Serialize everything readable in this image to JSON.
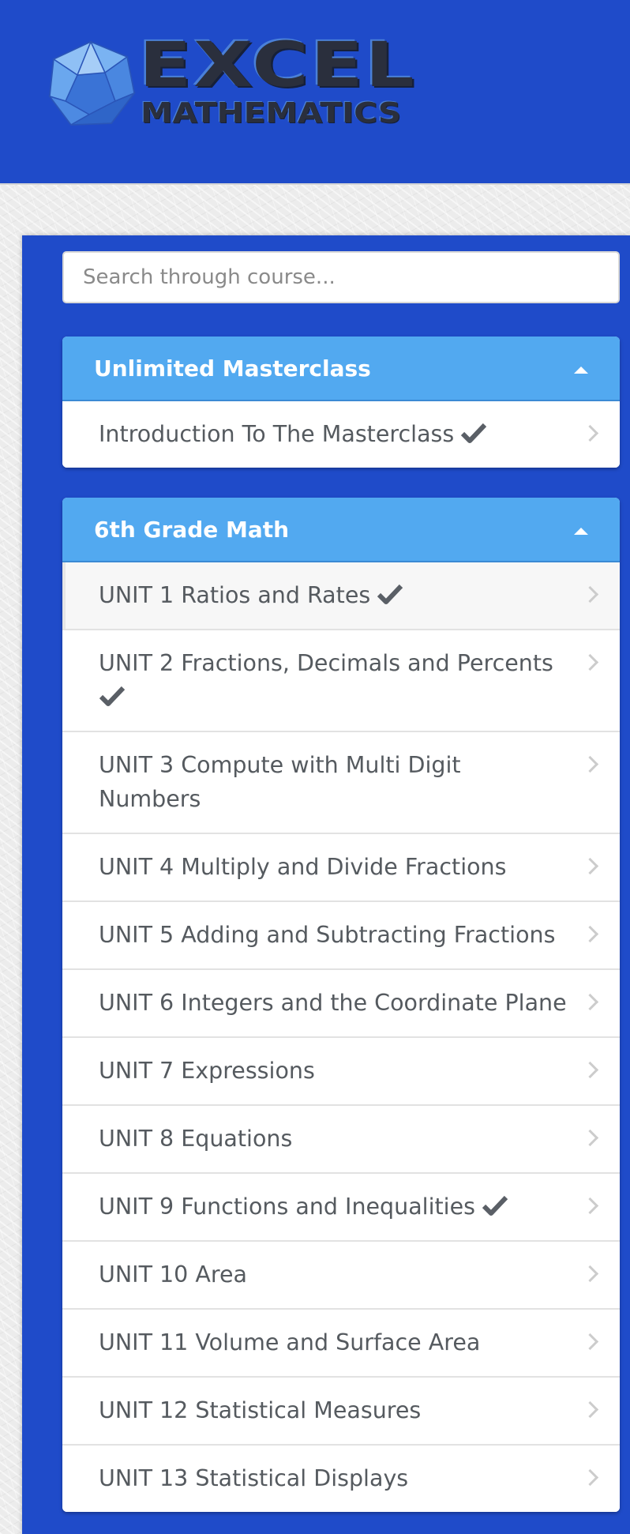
{
  "header": {
    "brand_main": "EXCEL",
    "brand_sub": "MATHEMATICS",
    "bg_color": "#1f4bc9"
  },
  "sidebar": {
    "search": {
      "placeholder": "Search through course...",
      "value": ""
    },
    "sections": [
      {
        "title": "Unlimited Masterclass",
        "expanded": true,
        "items": [
          {
            "label": "Introduction To The Masterclass",
            "completed": true
          }
        ]
      },
      {
        "title": "6th Grade Math",
        "expanded": true,
        "items": [
          {
            "label": "UNIT 1 Ratios and Rates",
            "completed": true,
            "active": true
          },
          {
            "label": "UNIT 2 Fractions, Decimals and Percents",
            "completed": true
          },
          {
            "label": "UNIT 3 Compute with Multi Digit Numbers",
            "completed": false
          },
          {
            "label": "UNIT 4 Multiply and Divide Fractions",
            "completed": false
          },
          {
            "label": "UNIT 5 Adding and Subtracting Fractions",
            "completed": false
          },
          {
            "label": "UNIT 6 Integers and the Coordinate Plane",
            "completed": false
          },
          {
            "label": "UNIT 7 Expressions",
            "completed": false
          },
          {
            "label": "UNIT 8 Equations",
            "completed": false
          },
          {
            "label": "UNIT 9 Functions and Inequalities",
            "completed": true
          },
          {
            "label": "UNIT 10 Area",
            "completed": false
          },
          {
            "label": "UNIT 11 Volume and Surface Area",
            "completed": false
          },
          {
            "label": "UNIT 12 Statistical Measures",
            "completed": false
          },
          {
            "label": "UNIT 13 Statistical Displays",
            "completed": false
          }
        ]
      }
    ]
  },
  "colors": {
    "panel_header": "#52a9f0",
    "sidebar_bg": "#1f4bc9",
    "item_text": "#555a5f",
    "check": "#5a5f66",
    "chevron": "#cccccc"
  },
  "icons": {
    "logo": "icosahedron-logo",
    "collapse": "caret-up-icon",
    "completed": "check-icon",
    "go": "chevron-right-icon"
  }
}
